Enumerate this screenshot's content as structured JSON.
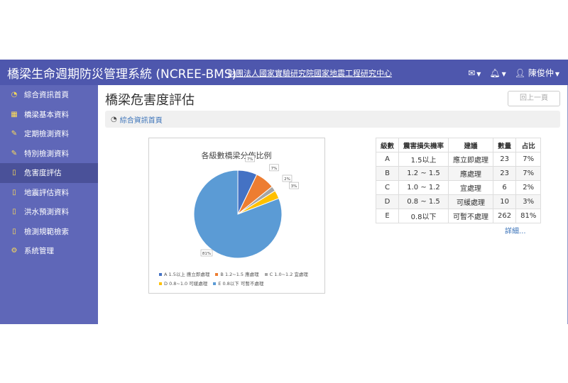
{
  "header": {
    "title": "橋梁生命週期防災管理系統 (NCREE-BMS)",
    "org": "財團法人國家實驗研究院國家地震工程研究中心",
    "user": "陳俊仲"
  },
  "sidebar": {
    "items": [
      {
        "label": "綜合資訊首頁",
        "icon": "dashboard-icon"
      },
      {
        "label": "橋梁基本資料",
        "icon": "table-icon"
      },
      {
        "label": "定期檢測資料",
        "icon": "edit-icon"
      },
      {
        "label": "特別檢測資料",
        "icon": "edit-icon"
      },
      {
        "label": "危害度評估",
        "icon": "file-icon"
      },
      {
        "label": "地震評估資料",
        "icon": "file-icon"
      },
      {
        "label": "洪水預測資料",
        "icon": "file-icon"
      },
      {
        "label": "檢測規範檢索",
        "icon": "file-icon"
      },
      {
        "label": "系統管理",
        "icon": "gear-icon"
      }
    ],
    "active_index": 4
  },
  "main": {
    "page_title": "橋梁危害度評估",
    "back_label": "回上一頁",
    "breadcrumb": "綜合資訊首頁",
    "more_label": "詳細..."
  },
  "chart_data": {
    "type": "pie",
    "title": "各級數橋梁分佈比例",
    "categories": [
      "A 1.5以上 應立即處理",
      "B 1.2~1.5 應處理",
      "C 1.0~1.2 宜處理",
      "D 0.8~1.0 可緩處理",
      "E 0.8以下 可暫不處理"
    ],
    "values": [
      23,
      23,
      6,
      10,
      262
    ],
    "labels": [
      "7%",
      "7%",
      "2%",
      "3%",
      "81%"
    ],
    "colors": [
      "#4472c4",
      "#ed7d31",
      "#a5a5a5",
      "#ffc000",
      "#5b9bd5"
    ],
    "legend": "bottom"
  },
  "table": {
    "headers": [
      "級數",
      "震害損失機率",
      "建議",
      "數量",
      "占比"
    ],
    "rows": [
      [
        "A",
        "1.5以上",
        "應立即處理",
        "23",
        "7%"
      ],
      [
        "B",
        "1.2 ~ 1.5",
        "應處理",
        "23",
        "7%"
      ],
      [
        "C",
        "1.0 ~ 1.2",
        "宜處理",
        "6",
        "2%"
      ],
      [
        "D",
        "0.8 ~ 1.5",
        "可緩處理",
        "10",
        "3%"
      ],
      [
        "E",
        "0.8以下",
        "可暫不處理",
        "262",
        "81%"
      ]
    ]
  }
}
